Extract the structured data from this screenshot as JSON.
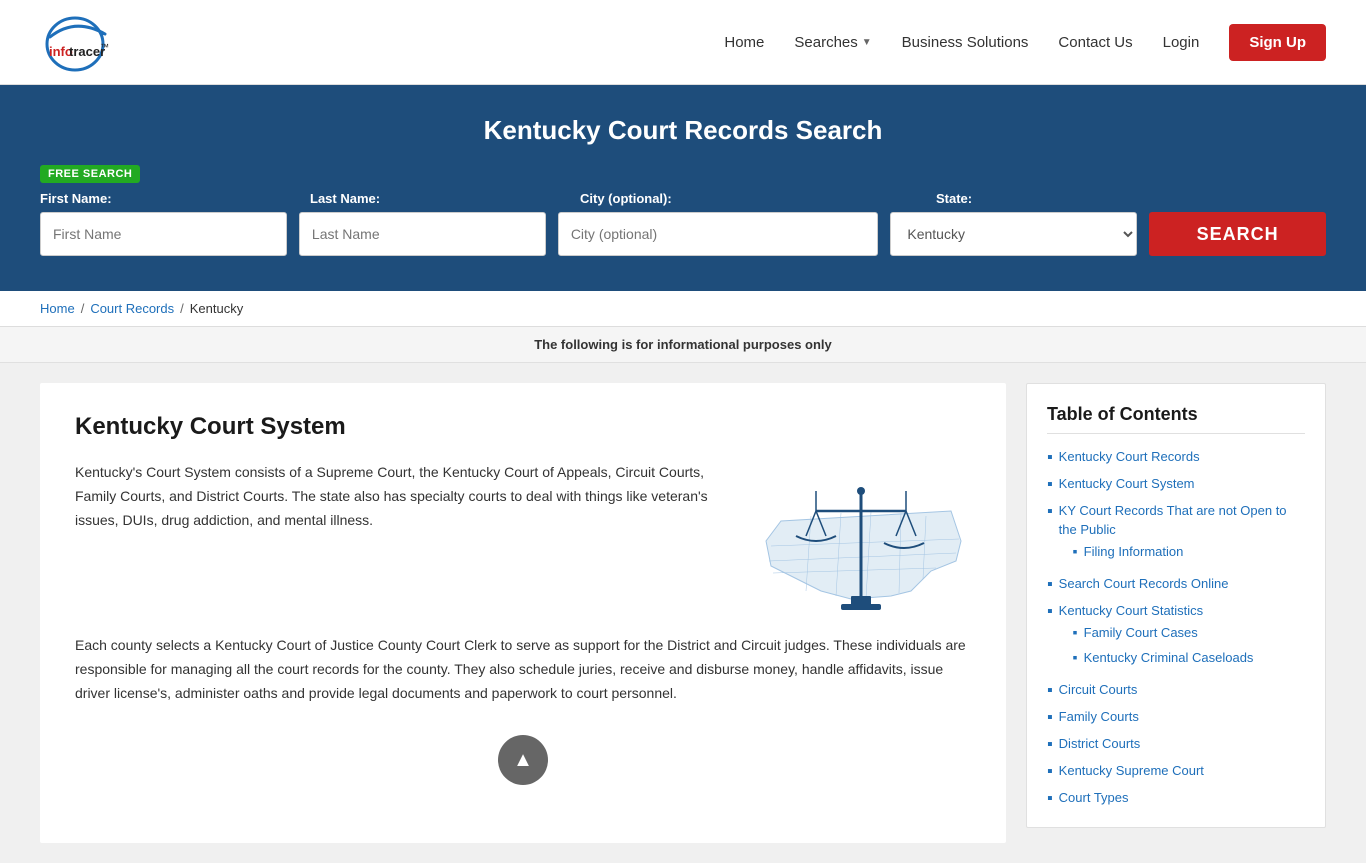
{
  "header": {
    "logo_info": "info",
    "logo_tracer": "tracer",
    "logo_tm": "™",
    "nav": {
      "home": "Home",
      "searches": "Searches",
      "business_solutions": "Business Solutions",
      "contact_us": "Contact Us",
      "login": "Login",
      "signup": "Sign Up"
    }
  },
  "search_banner": {
    "title": "Kentucky Court Records Search",
    "free_badge": "FREE SEARCH",
    "first_name_label": "First Name:",
    "last_name_label": "Last Name:",
    "city_label": "City (optional):",
    "state_label": "State:",
    "first_name_placeholder": "First Name",
    "last_name_placeholder": "Last Name",
    "city_placeholder": "City (optional)",
    "state_value": "Kentucky",
    "search_button": "SEARCH"
  },
  "breadcrumb": {
    "home": "Home",
    "court_records": "Court Records",
    "current": "Kentucky"
  },
  "info_bar": {
    "text": "The following is for informational purposes only"
  },
  "article": {
    "heading": "Kentucky Court System",
    "para1": "Kentucky's Court System consists of a Supreme Court, the Kentucky Court of Appeals, Circuit Courts, Family Courts, and District Courts. The state also has specialty courts to deal with things like veteran's issues, DUIs, drug addiction, and mental illness.",
    "para2": "Each county selects a Kentucky Court of Justice County Court Clerk to serve as support for the District and Circuit judges. These individuals are responsible for managing all the court records for the county. They also schedule juries, receive and disburse money, handle affidavits, issue driver license's, administer oaths and provide legal documents and paperwork to court personnel."
  },
  "toc": {
    "title": "Table of Contents",
    "items": [
      {
        "label": "Kentucky Court Records",
        "href": "#"
      },
      {
        "label": "Kentucky Court System",
        "href": "#"
      },
      {
        "label": "KY Court Records That are not Open to the Public",
        "href": "#",
        "sub": [
          {
            "label": "Filing Information",
            "href": "#"
          }
        ]
      },
      {
        "label": "Search Court Records Online",
        "href": "#"
      },
      {
        "label": "Kentucky Court Statistics",
        "href": "#",
        "sub": [
          {
            "label": "Family Court Cases",
            "href": "#"
          },
          {
            "label": "Kentucky Criminal Caseloads",
            "href": "#"
          }
        ]
      },
      {
        "label": "Circuit Courts",
        "href": "#"
      },
      {
        "label": "Family Courts",
        "href": "#"
      },
      {
        "label": "District Courts",
        "href": "#"
      },
      {
        "label": "Kentucky Supreme Court",
        "href": "#"
      },
      {
        "label": "Court Types",
        "href": "#"
      }
    ]
  }
}
